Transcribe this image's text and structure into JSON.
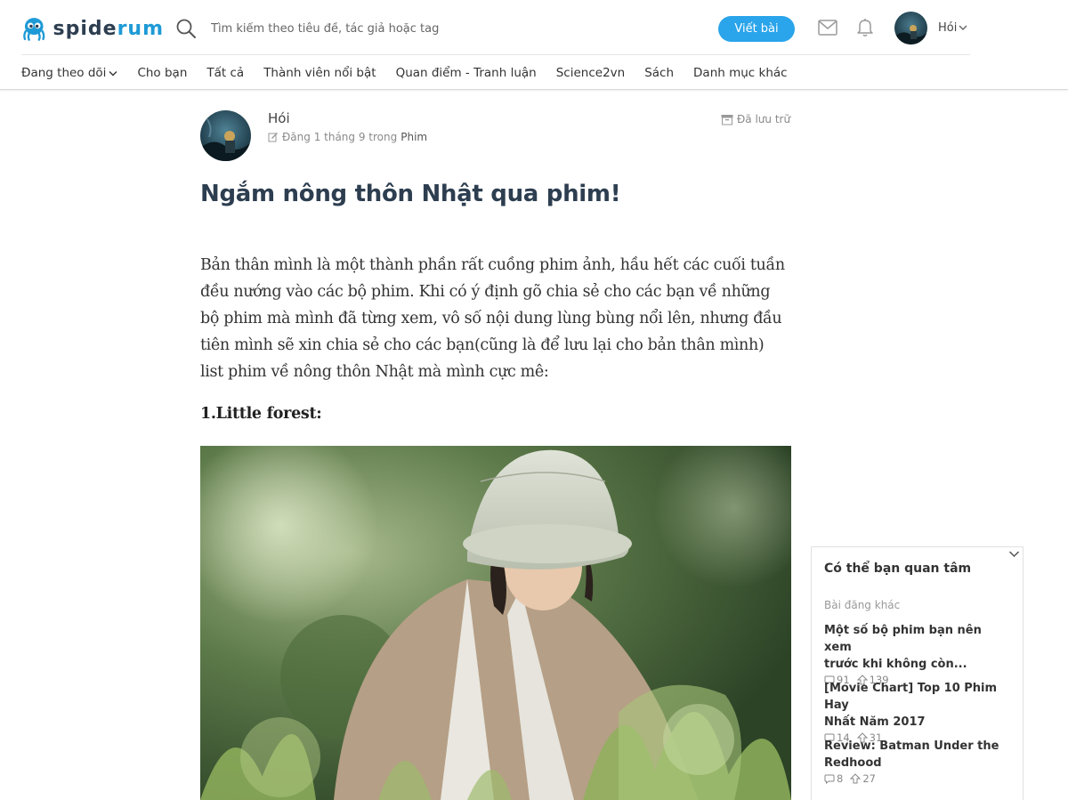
{
  "header": {
    "logo": {
      "text_part1": "spide",
      "text_part2": "rum"
    },
    "search": {
      "placeholder": "Tìm kiếm theo tiêu đề, tác giả hoặc tag"
    },
    "write_button": "Viết bài",
    "user_name": "Hói"
  },
  "nav": {
    "items": [
      {
        "label": "Đang theo dõi",
        "dropdown": true
      },
      {
        "label": "Cho bạn"
      },
      {
        "label": "Tất cả"
      },
      {
        "label": "Thành viên nổi bật"
      },
      {
        "label": "Quan điểm - Tranh luận"
      },
      {
        "label": "Science2vn"
      },
      {
        "label": "Sách"
      },
      {
        "label": "Danh mục khác"
      }
    ]
  },
  "article": {
    "author": "Hói",
    "meta_prefix": "Đăng 1 tháng 9 trong",
    "category": "Phim",
    "archived_label": "Đã lưu trữ",
    "title": "Ngắm nông thôn Nhật qua phim!",
    "paragraph_lines": [
      "Bản thân mình là một thành phần rất cuồng phim ảnh, hầu hết các cuối tuần",
      "đều nướng vào các bộ phim. Khi có ý định gõ chia sẻ cho các bạn về những",
      "bộ phim mà mình đã từng xem, vô số nội dung lùng bùng nổi lên, nhưng đầu",
      "tiên mình sẽ xin chia sẻ cho các bạn(cũng là để lưu lại cho bản thân mình)",
      "list phim về nông thôn Nhật mà mình cực mê:"
    ],
    "section_heading": "1.Little forest:"
  },
  "sidebar": {
    "title": "Có thể bạn quan tâm",
    "subtitle": "Bài đăng khác",
    "items": [
      {
        "title_lines": [
          "Một số bộ phim bạn nên xem",
          "trước khi không còn..."
        ],
        "comments": "91",
        "upvotes": "139"
      },
      {
        "title_lines": [
          "[Movie Chart] Top 10 Phim Hay",
          "Nhất Năm 2017"
        ],
        "comments": "14",
        "upvotes": "31"
      },
      {
        "title_lines": [
          "Review: Batman Under the",
          "Redhood"
        ],
        "comments": "8",
        "upvotes": "27"
      }
    ]
  },
  "colors": {
    "brand_blue": "#2aa4ea",
    "logo_dark": "#2d3e50",
    "title_color": "#2d3e50"
  },
  "icons": [
    "spider-logo-icon",
    "search-icon",
    "mail-icon",
    "bell-icon",
    "chevron-down-icon",
    "pen-icon",
    "archive-icon",
    "comment-icon",
    "upvote-icon"
  ]
}
